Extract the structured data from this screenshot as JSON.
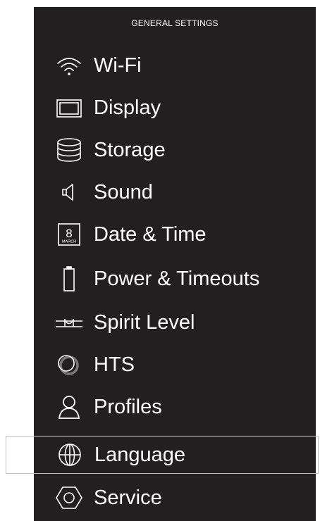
{
  "header": {
    "title": "GENERAL SETTINGS"
  },
  "menu": {
    "items": [
      {
        "label": "Wi-Fi",
        "icon": "wifi-icon"
      },
      {
        "label": "Display",
        "icon": "display-icon"
      },
      {
        "label": "Storage",
        "icon": "storage-icon"
      },
      {
        "label": "Sound",
        "icon": "speaker-icon"
      },
      {
        "label": "Date & Time",
        "icon": "calendar-icon"
      },
      {
        "label": "Power & Timeouts",
        "icon": "battery-icon"
      },
      {
        "label": "Spirit Level",
        "icon": "spirit-level-icon"
      },
      {
        "label": "HTS",
        "icon": "hts-icon"
      },
      {
        "label": "Profiles",
        "icon": "person-icon"
      },
      {
        "label": "Language",
        "icon": "globe-icon"
      },
      {
        "label": "Service",
        "icon": "nut-icon"
      }
    ],
    "selected_index": 9
  },
  "calendar_icon": {
    "day": "8",
    "month": "MARCH"
  },
  "colors": {
    "panel_background": "#231f20",
    "text": "#ffffff",
    "selection_border": "#bfbfbf",
    "page_background": "#ffffff"
  }
}
